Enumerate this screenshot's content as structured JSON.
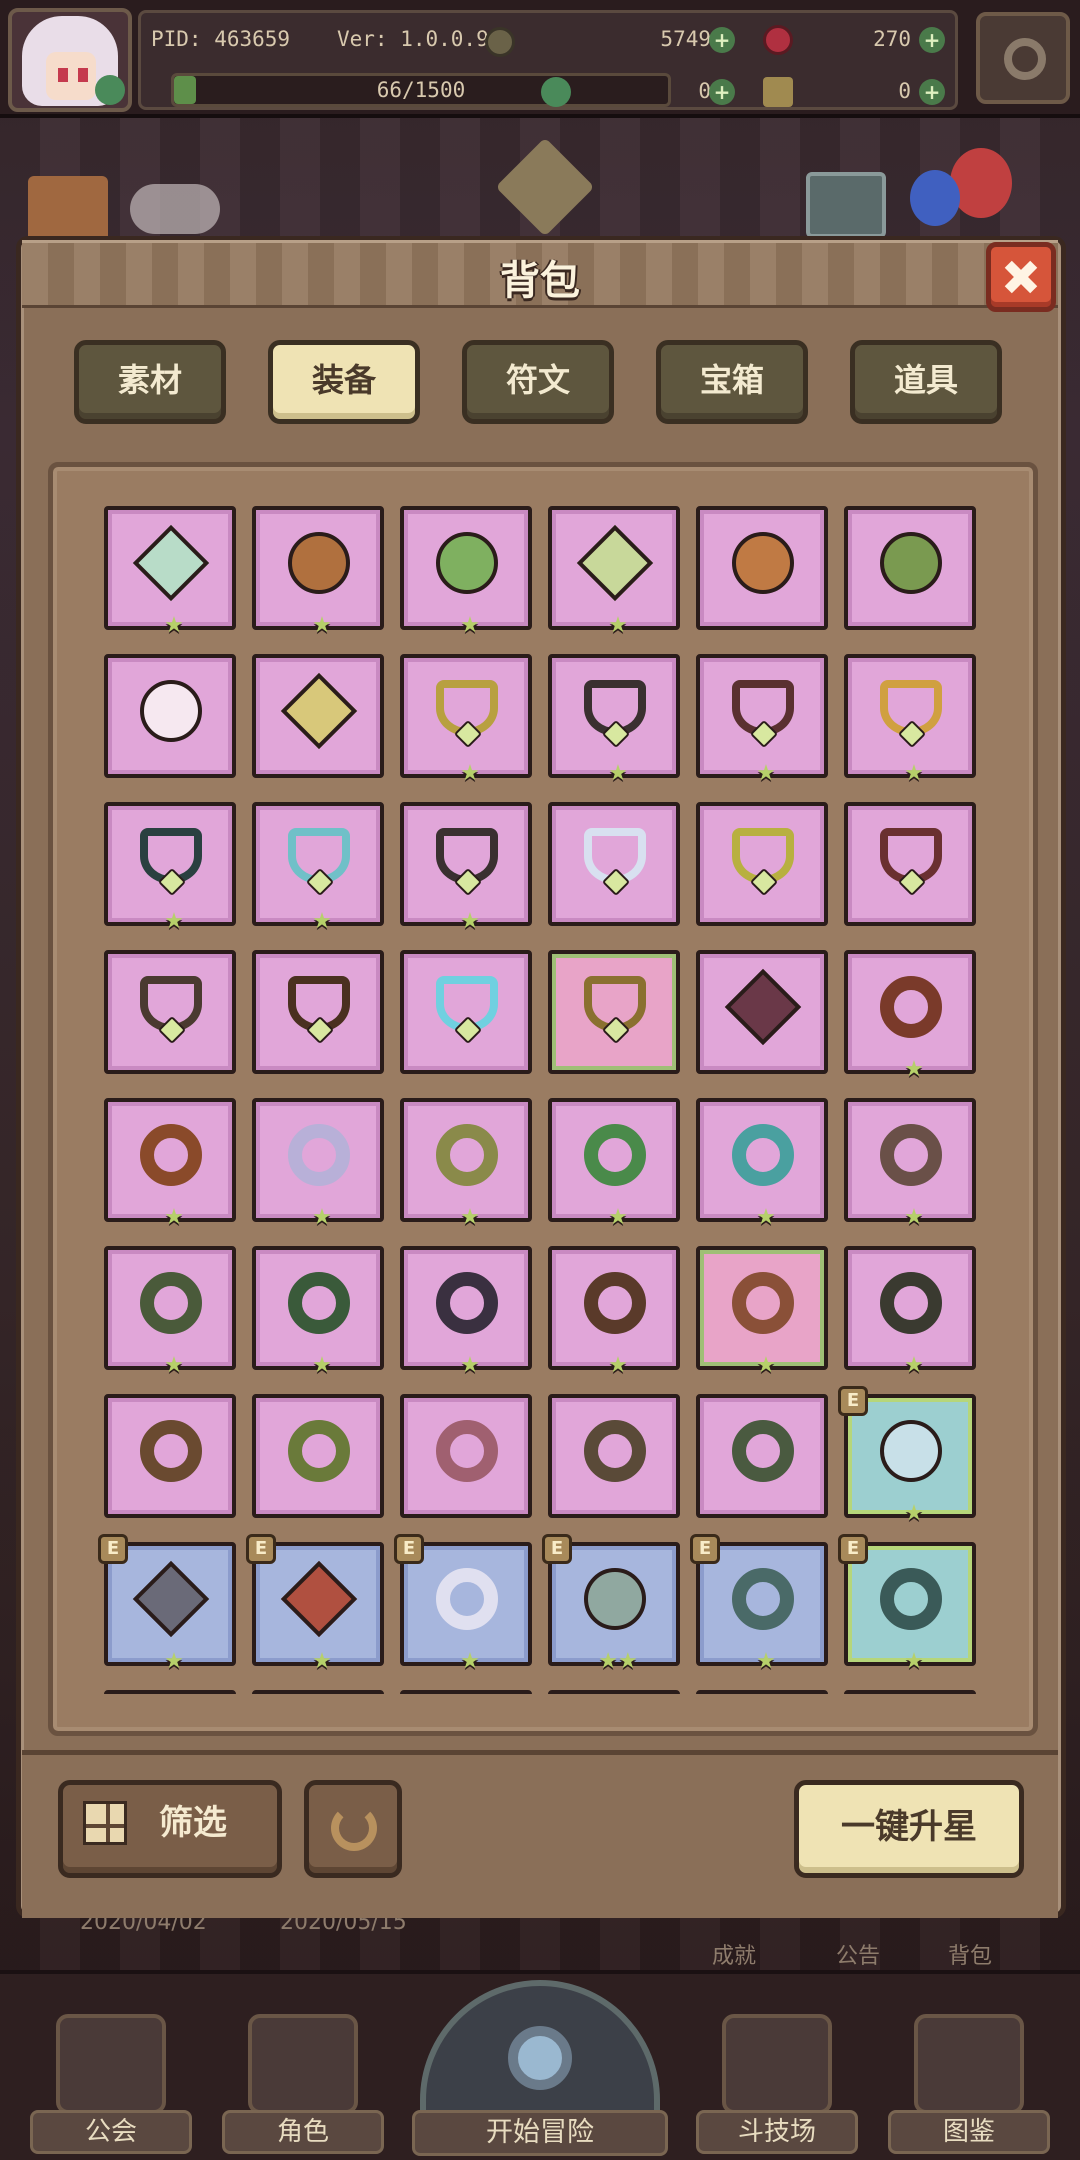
{
  "hud": {
    "pid": "PID: 463659",
    "version": "Ver: 1.0.0.9",
    "gold": "5749",
    "gems": "270",
    "clover_currency": "0",
    "scroll_currency": "0",
    "stamina_text": "66/1500",
    "stamina_fraction": 0.044
  },
  "dialog": {
    "title": "背包",
    "tabs": [
      {
        "label": "素材",
        "active": false
      },
      {
        "label": "装备",
        "active": true
      },
      {
        "label": "符文",
        "active": false
      },
      {
        "label": "宝箱",
        "active": false
      },
      {
        "label": "道具",
        "active": false
      }
    ],
    "items": [
      {
        "quality": "pink",
        "shape": "diamond",
        "color": "#b8dcc8",
        "stars": 1,
        "equipped": false
      },
      {
        "quality": "pink",
        "shape": "round",
        "color": "#b0703e",
        "stars": 1,
        "equipped": false
      },
      {
        "quality": "pink",
        "shape": "round",
        "color": "#7fb060",
        "stars": 1,
        "equipped": false
      },
      {
        "quality": "pink",
        "shape": "diamond",
        "color": "#c8d89a",
        "stars": 1,
        "equipped": false
      },
      {
        "quality": "pink",
        "shape": "round",
        "color": "#c07a44",
        "stars": 0,
        "equipped": false
      },
      {
        "quality": "pink",
        "shape": "round",
        "color": "#7a9a50",
        "stars": 0,
        "equipped": false
      },
      {
        "quality": "pink",
        "shape": "round",
        "color": "#f6e8f0",
        "stars": 0,
        "equipped": false
      },
      {
        "quality": "pink",
        "shape": "diamond",
        "color": "#d8c87a",
        "stars": 0,
        "equipped": false
      },
      {
        "quality": "pink",
        "shape": "heart",
        "color": "#b8a040",
        "stars": 1,
        "equipped": false
      },
      {
        "quality": "pink",
        "shape": "heart",
        "color": "#3a3030",
        "stars": 1,
        "equipped": false
      },
      {
        "quality": "pink",
        "shape": "heart",
        "color": "#5a3030",
        "stars": 1,
        "equipped": false
      },
      {
        "quality": "pink",
        "shape": "heart",
        "color": "#d0a040",
        "stars": 1,
        "equipped": false
      },
      {
        "quality": "pink",
        "shape": "heart",
        "color": "#2a4040",
        "stars": 1,
        "equipped": false
      },
      {
        "quality": "pink",
        "shape": "heart",
        "color": "#70c0c8",
        "stars": 1,
        "equipped": false
      },
      {
        "quality": "pink",
        "shape": "heart",
        "color": "#3a3030",
        "stars": 1,
        "equipped": false
      },
      {
        "quality": "pink",
        "shape": "heart",
        "color": "#d8e0f0",
        "stars": 0,
        "equipped": false
      },
      {
        "quality": "pink",
        "shape": "heart",
        "color": "#b8b040",
        "stars": 0,
        "equipped": false
      },
      {
        "quality": "pink",
        "shape": "heart",
        "color": "#6a3030",
        "stars": 0,
        "equipped": false
      },
      {
        "quality": "pink",
        "shape": "heart",
        "color": "#4a3a30",
        "stars": 0,
        "equipped": false
      },
      {
        "quality": "pink",
        "shape": "heart",
        "color": "#4a3020",
        "stars": 0,
        "equipped": false
      },
      {
        "quality": "pink",
        "shape": "heart",
        "color": "#70d0e0",
        "stars": 0,
        "equipped": false
      },
      {
        "quality": "pink-g",
        "shape": "heart",
        "color": "#8a7030",
        "stars": 0,
        "equipped": false
      },
      {
        "quality": "pink",
        "shape": "diamond",
        "color": "#6a3848",
        "stars": 0,
        "equipped": false
      },
      {
        "quality": "pink",
        "shape": "ring",
        "color": "#7a3a2a",
        "stars": 1,
        "equipped": false
      },
      {
        "quality": "pink",
        "shape": "ring",
        "color": "#8a4a2a",
        "stars": 1,
        "equipped": false
      },
      {
        "quality": "pink",
        "shape": "ring",
        "color": "#b8b0d8",
        "stars": 1,
        "equipped": false
      },
      {
        "quality": "pink",
        "shape": "ring",
        "color": "#8a8a4a",
        "stars": 1,
        "equipped": false
      },
      {
        "quality": "pink",
        "shape": "ring",
        "color": "#4a8a4a",
        "stars": 1,
        "equipped": false
      },
      {
        "quality": "pink",
        "shape": "ring",
        "color": "#4aa0a0",
        "stars": 1,
        "equipped": false
      },
      {
        "quality": "pink",
        "shape": "ring",
        "color": "#6a5048",
        "stars": 1,
        "equipped": false
      },
      {
        "quality": "pink",
        "shape": "ring",
        "color": "#4a5a3a",
        "stars": 1,
        "equipped": false
      },
      {
        "quality": "pink",
        "shape": "ring",
        "color": "#3a5a3a",
        "stars": 1,
        "equipped": false
      },
      {
        "quality": "pink",
        "shape": "ring",
        "color": "#3a3040",
        "stars": 1,
        "equipped": false
      },
      {
        "quality": "pink",
        "shape": "ring",
        "color": "#5a3a2a",
        "stars": 1,
        "equipped": false
      },
      {
        "quality": "pink-g",
        "shape": "ring",
        "color": "#8a5038",
        "stars": 1,
        "equipped": false
      },
      {
        "quality": "pink",
        "shape": "ring",
        "color": "#3a3a30",
        "stars": 1,
        "equipped": false
      },
      {
        "quality": "pink",
        "shape": "ring",
        "color": "#6a4a30",
        "stars": 0,
        "equipped": false
      },
      {
        "quality": "pink",
        "shape": "ring",
        "color": "#6a7a3a",
        "stars": 0,
        "equipped": false
      },
      {
        "quality": "pink",
        "shape": "ring",
        "color": "#a06070",
        "stars": 0,
        "equipped": false
      },
      {
        "quality": "pink",
        "shape": "ring",
        "color": "#5a4a38",
        "stars": 0,
        "equipped": false
      },
      {
        "quality": "pink",
        "shape": "ring",
        "color": "#4a5a40",
        "stars": 0,
        "equipped": false
      },
      {
        "quality": "teal",
        "shape": "round",
        "color": "#c8e0e8",
        "stars": 1,
        "equipped": true
      },
      {
        "quality": "blue",
        "shape": "diamond",
        "color": "#6a6a78",
        "stars": 1,
        "equipped": true
      },
      {
        "quality": "blue",
        "shape": "diamond",
        "color": "#b05040",
        "stars": 1,
        "equipped": true
      },
      {
        "quality": "blue",
        "shape": "ring",
        "color": "#e0e0f0",
        "stars": 1,
        "equipped": true
      },
      {
        "quality": "blue",
        "shape": "round",
        "color": "#90a8a0",
        "stars": 2,
        "equipped": true
      },
      {
        "quality": "blue",
        "shape": "ring",
        "color": "#4a6a68",
        "stars": 1,
        "equipped": true
      },
      {
        "quality": "teal",
        "shape": "ring",
        "color": "#3a5a58",
        "stars": 1,
        "equipped": true
      },
      {
        "quality": "teal",
        "shape": "round",
        "color": "#8ab060",
        "stars": 0,
        "equipped": false
      },
      {
        "quality": "blue",
        "shape": "round",
        "color": "#90a8c8",
        "stars": 0,
        "equipped": false
      },
      {
        "quality": "teal",
        "shape": "round",
        "color": "#8ab060",
        "stars": 0,
        "equipped": false
      },
      {
        "quality": "blue",
        "shape": "round",
        "color": "#90a8c8",
        "stars": 0,
        "equipped": false
      },
      {
        "quality": "blue",
        "shape": "round",
        "color": "#90a8c8",
        "stars": 0,
        "equipped": false
      },
      {
        "quality": "blue",
        "shape": "round",
        "color": "#90a8c8",
        "stars": 0,
        "equipped": false
      }
    ],
    "equip_badge": "E",
    "star_glyph": "★",
    "filter_label": "筛选",
    "upgrade_label": "一键升星"
  },
  "background": {
    "date_start": "2020/04/02",
    "date_end": "2020/05/15",
    "links": [
      "成就",
      "公告",
      "背包"
    ]
  },
  "nav": {
    "guild": "公会",
    "character": "角色",
    "adventure": "开始冒险",
    "arena": "斗技场",
    "codex": "图鉴"
  },
  "colors": {
    "accent_gold": "#efe3b4",
    "close_red": "#d6553a",
    "star_green": "#b6d06a",
    "panel_brown": "#8a6f58"
  }
}
